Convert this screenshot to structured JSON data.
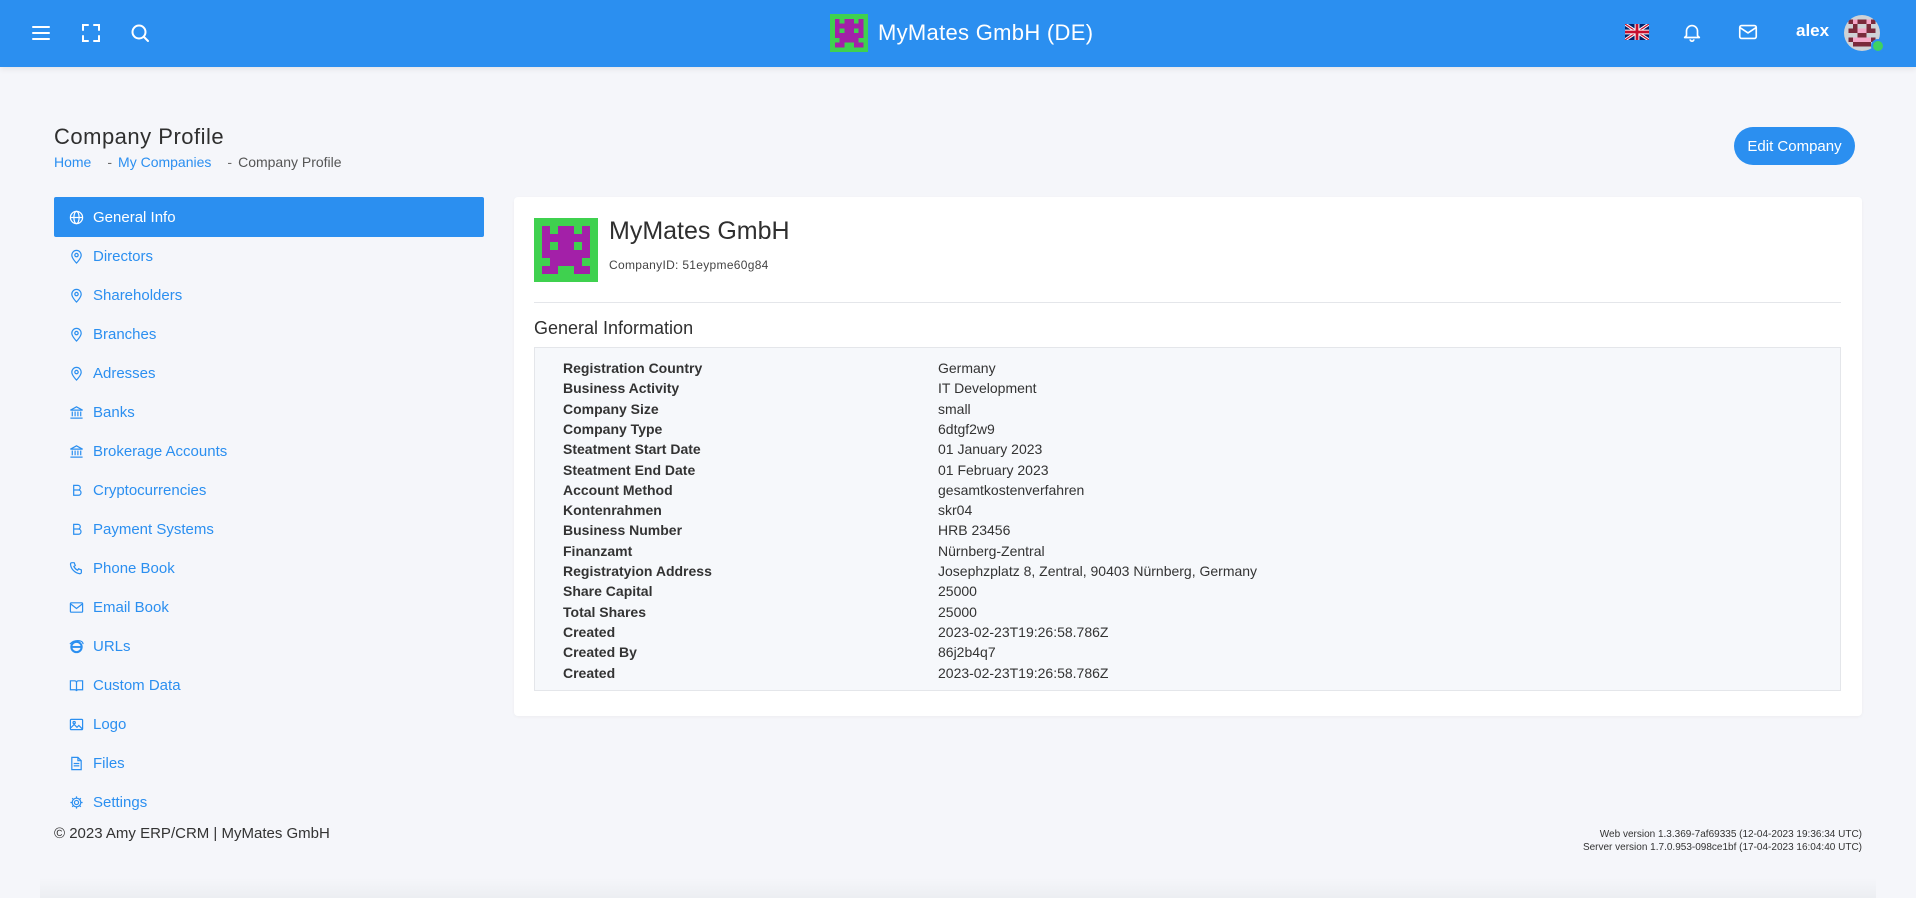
{
  "header": {
    "title": "MyMates GmbH (DE)",
    "user": "alex",
    "icons": [
      "menu-icon",
      "fullscreen-icon",
      "search-icon",
      "uk-flag-icon",
      "bell-icon",
      "mail-icon"
    ]
  },
  "page": {
    "title": "Company Profile",
    "breadcrumb": {
      "home": "Home",
      "sep1": "-",
      "companies": "My Companies",
      "sep2": "-",
      "current": "Company Profile"
    },
    "edit_button": "Edit Company"
  },
  "sidebar": {
    "items": [
      {
        "label": "General Info",
        "icon": "globe-icon"
      },
      {
        "label": "Directors",
        "icon": "map-pin-icon"
      },
      {
        "label": "Shareholders",
        "icon": "map-pin-icon"
      },
      {
        "label": "Branches",
        "icon": "map-pin-icon"
      },
      {
        "label": "Adresses",
        "icon": "map-pin-icon"
      },
      {
        "label": "Banks",
        "icon": "bank-icon"
      },
      {
        "label": "Brokerage Accounts",
        "icon": "bank-icon"
      },
      {
        "label": "Cryptocurrencies",
        "icon": "bitcoin-icon"
      },
      {
        "label": "Payment Systems",
        "icon": "bitcoin-icon"
      },
      {
        "label": "Phone Book",
        "icon": "phone-icon"
      },
      {
        "label": "Email Book",
        "icon": "mail-icon"
      },
      {
        "label": "URLs",
        "icon": "internet-explorer-icon"
      },
      {
        "label": "Custom Data",
        "icon": "book-icon"
      },
      {
        "label": "Logo",
        "icon": "image-icon"
      },
      {
        "label": "Files",
        "icon": "file-icon"
      },
      {
        "label": "Settings",
        "icon": "gear-icon"
      }
    ]
  },
  "company": {
    "name": "MyMates GmbH",
    "id": "CompanyID: 51eypme60g84"
  },
  "general": {
    "title": "General Information",
    "rows": [
      {
        "label": "Registration Country",
        "value": "Germany"
      },
      {
        "label": "Business Activity",
        "value": "IT Development"
      },
      {
        "label": "Company Size",
        "value": "small"
      },
      {
        "label": "Company Type",
        "value": "6dtgf2w9"
      },
      {
        "label": "Steatment Start Date",
        "value": "01 January 2023"
      },
      {
        "label": "Steatment End Date",
        "value": "01 February 2023"
      },
      {
        "label": "Account Method",
        "value": "gesamtkostenverfahren"
      },
      {
        "label": "Kontenrahmen",
        "value": "skr04"
      },
      {
        "label": "Business Number",
        "value": "HRB 23456"
      },
      {
        "label": "Finanzamt",
        "value": "Nürnberg-Zentral"
      },
      {
        "label": "Registratyion Address",
        "value": "Josephzplatz 8, Zentral, 90403 Nürnberg, Germany"
      },
      {
        "label": "Share Capital",
        "value": "25000"
      },
      {
        "label": "Total Shares",
        "value": "25000"
      },
      {
        "label": "Created",
        "value": "2023-02-23T19:26:58.786Z"
      },
      {
        "label": "Created By",
        "value": "86j2b4q7"
      },
      {
        "label": "Created",
        "value": "2023-02-23T19:26:58.786Z"
      }
    ]
  },
  "footer": {
    "copyright": "© 2023 Amy ERP/CRM | MyMates GmbH",
    "web_version": "Web version 1.3.369-7af69335 (12-04-2023 19:36:34 UTC)",
    "server_version": "Server version 1.7.0.953-098ce1bf (17-04-2023 16:04:40 UTC)"
  },
  "colors": {
    "primary": "#2b8ff0",
    "logo_green": "#3fd14f",
    "logo_magenta": "#a320a8"
  }
}
